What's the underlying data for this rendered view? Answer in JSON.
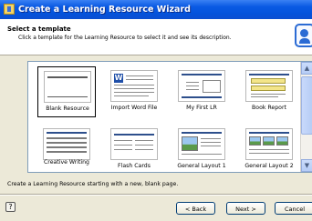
{
  "window": {
    "title": "Create a Learning Resource Wizard"
  },
  "header": {
    "heading": "Select a template",
    "instructions": "Click a template for the Learning Resource to select it and see its description."
  },
  "templates": [
    {
      "label": "Blank Resource",
      "selected": true
    },
    {
      "label": "Import Word File",
      "selected": false
    },
    {
      "label": "My First LR",
      "selected": false
    },
    {
      "label": "Book Report",
      "selected": false
    },
    {
      "label": "Creative Writing",
      "selected": false
    },
    {
      "label": "Flash Cards",
      "selected": false
    },
    {
      "label": "General Layout 1",
      "selected": false
    },
    {
      "label": "General Layout 2",
      "selected": false
    }
  ],
  "status": "Create a Learning Resource starting with a new, blank page.",
  "buttons": {
    "back": "< Back",
    "next": "Next >",
    "cancel": "Cancel"
  },
  "icons": {
    "scroll_up": "▲",
    "scroll_down": "▼",
    "help": "?"
  },
  "colors": {
    "titlebar": "#0a5ae3",
    "accent": "#2d4f8c"
  }
}
